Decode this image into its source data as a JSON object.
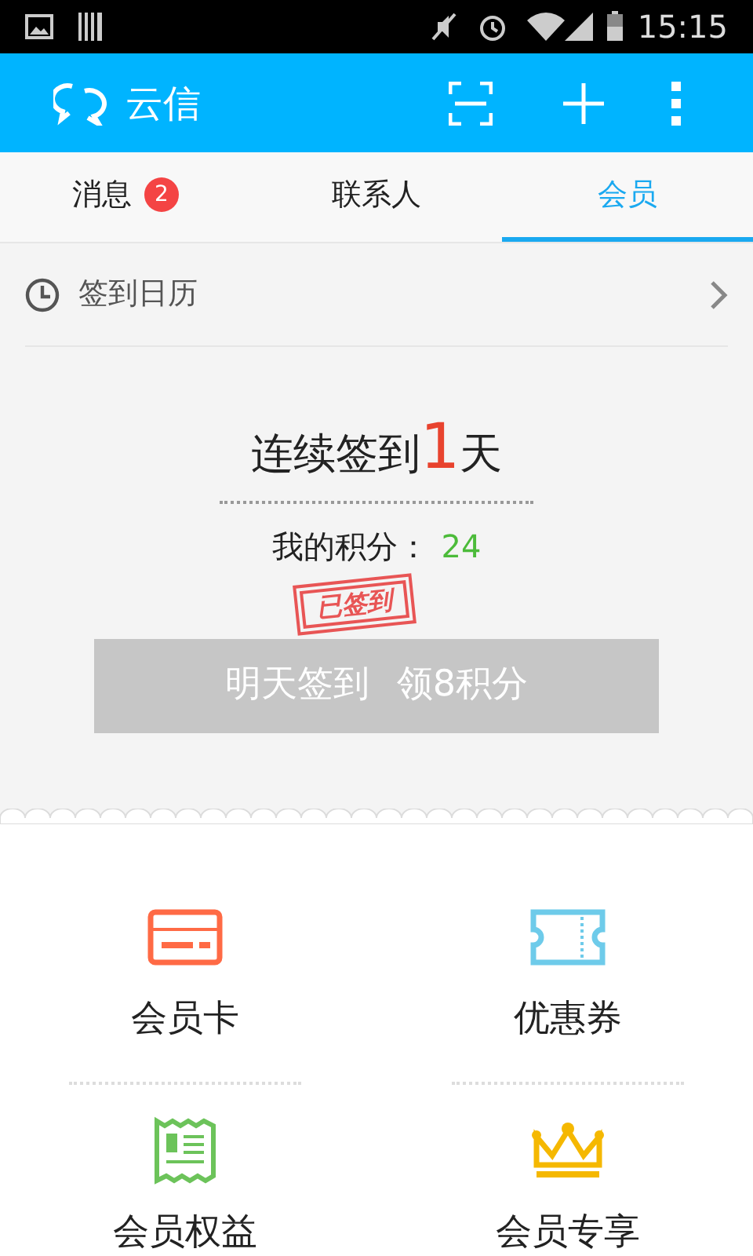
{
  "status_bar": {
    "time": "15:15"
  },
  "app_bar": {
    "title": "云信"
  },
  "tabs": [
    {
      "label": "消息",
      "badge": "2",
      "selected": false
    },
    {
      "label": "联系人",
      "selected": false
    },
    {
      "label": "会员",
      "selected": true
    }
  ],
  "calendar_link": {
    "label": "签到日历"
  },
  "checkin": {
    "streak_prefix": "连续签到",
    "streak_days": "1",
    "streak_suffix": "天",
    "points_label": "我的积分：",
    "points": "24",
    "stamp": "已签到",
    "button": "明天签到 领8积分",
    "disabled": true
  },
  "menu": [
    {
      "kind": "card",
      "label": "会员卡"
    },
    {
      "kind": "coupon",
      "label": "优惠券"
    },
    {
      "kind": "benefits",
      "label": "会员权益"
    },
    {
      "kind": "crown",
      "label": "会员专享"
    }
  ]
}
